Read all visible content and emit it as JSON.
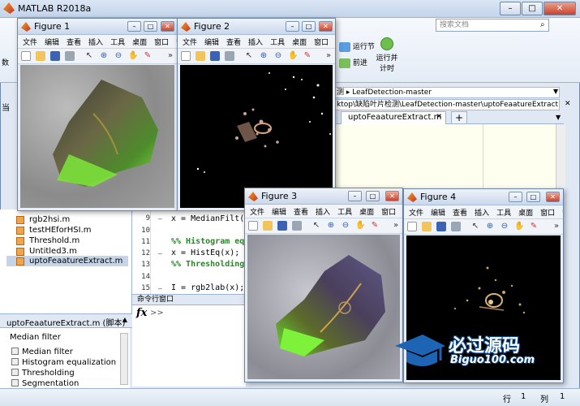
{
  "app": {
    "title": "MATLAB R2018a",
    "search_placeholder": "搜索文档",
    "window_buttons": [
      "–",
      "□",
      "✕"
    ]
  },
  "ribbon": {
    "run_section": "运行节",
    "advance": "前进",
    "run_and_time": "运行并计时",
    "left_labels": [
      "数",
      "当"
    ]
  },
  "address": {
    "folder_crumb": "测 ▸ LeafDetection-master",
    "path": "ktop\\缺陷叶片检测\\LeafDetection-master\\uptoFeaatureExtract..."
  },
  "editor": {
    "active_tab": "uptoFeaatureExtract.m",
    "add_tab": "+",
    "lines": [
      {
        "num": "9",
        "dash": "–",
        "code": "x = MedianFilt(x)",
        "comment": false
      },
      {
        "num": "10",
        "dash": "",
        "code": "",
        "comment": false
      },
      {
        "num": "11",
        "dash": "",
        "code": "%% Histogram eq",
        "comment": true
      },
      {
        "num": "12",
        "dash": "–",
        "code": "x = HistEq(x);",
        "comment": false
      },
      {
        "num": "13",
        "dash": "",
        "code": "%% Thresholding",
        "comment": true
      },
      {
        "num": "14",
        "dash": "",
        "code": "",
        "comment": false
      },
      {
        "num": "15",
        "dash": "–",
        "code": "I = rgb2lab(x);",
        "comment": false
      }
    ]
  },
  "files": {
    "items": [
      {
        "name": "rgb2hsi.m",
        "selected": false
      },
      {
        "name": "testHEforHSI.m",
        "selected": false
      },
      {
        "name": "Threshold.m",
        "selected": false
      },
      {
        "name": "Untitled3.m",
        "selected": false
      },
      {
        "name": "uptoFeaatureExtract.m",
        "selected": true
      }
    ]
  },
  "details": {
    "header": "uptoFeaatureExtract.m (脚本)",
    "title": "Median filter",
    "sections": [
      "Median filter",
      "Histogram equalization",
      "Thresholding",
      "Segmentation"
    ]
  },
  "command_window": {
    "header": "命令行窗口",
    "fx": "fx",
    "prompt": ">>"
  },
  "status": {
    "row_label": "行",
    "row_value": "1",
    "col_label": "列",
    "col_value": "1"
  },
  "figure_menu": [
    "文件",
    "编辑",
    "查看",
    "插入",
    "工具",
    "桌面",
    "窗口",
    "帮助"
  ],
  "figures": [
    {
      "title": "Figure 1"
    },
    {
      "title": "Figure 2"
    },
    {
      "title": "Figure 3"
    },
    {
      "title": "Figure 4"
    }
  ],
  "watermark": {
    "cn": "必过源码",
    "en": "Biguo100.com"
  },
  "colors": {
    "titlebar": "#c3d4ea",
    "comment": "#228b22",
    "selected_file": "#c5d4e6",
    "editor_bg": "#fffff0"
  }
}
